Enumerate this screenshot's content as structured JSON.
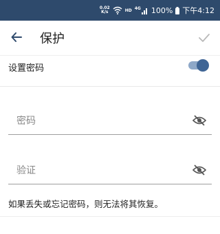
{
  "statusbar": {
    "net_speed_value": "0.02",
    "net_speed_unit": "K/s",
    "hd": "HD",
    "signal": "4G",
    "battery": "100%",
    "time": "下午4:12"
  },
  "appbar": {
    "title": "保护"
  },
  "settings": {
    "set_password_label": "设置密码",
    "set_password_enabled": true
  },
  "fields": {
    "password_placeholder": "密码",
    "verify_placeholder": "验证"
  },
  "note": "如果丢失或忘记密码，则无法将其恢复。",
  "colors": {
    "statusbar_bg": "#2e4a6c",
    "toggle_on": "#3f6595"
  }
}
